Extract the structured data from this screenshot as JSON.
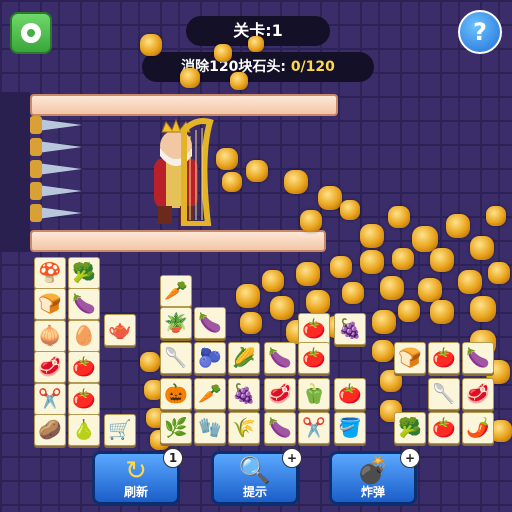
{
  "header": {
    "level_text": "关卡:1",
    "task_prefix": "消除120块石头: ",
    "task_progress": "0/120",
    "settings_icon": "gear-icon",
    "help_icon": "help-icon",
    "help_symbol": "?"
  },
  "colors": {
    "gold": "#e8a21a",
    "button": "#1b5ec9",
    "settings": "#45b045"
  },
  "tiles": [
    "🍄",
    "🥦",
    "🍞",
    "🍆",
    "🧅",
    "🥚",
    "🥩",
    "🍅",
    "✂️",
    "🍅",
    "🥔",
    "🍐",
    "🥕",
    "🪴",
    "🍆",
    "🍅",
    "🥄",
    "🫐",
    "🌽",
    "🍆",
    "🍅",
    "🍇",
    "🎃",
    "🥕",
    "🍇",
    "🥩",
    "🫑",
    "🍅",
    "🌿",
    "🧤",
    "🌾",
    "🍆",
    "✂️",
    "🪣",
    "🍞",
    "🍅",
    "🍆",
    "🥄",
    "🥦",
    "🍅",
    "🌶️",
    "🥩",
    "🫖",
    "🛒"
  ],
  "buttons": [
    {
      "label": "刷新",
      "icon": "↻",
      "badge": "1"
    },
    {
      "label": "提示",
      "icon": "🔍",
      "badge": "+"
    },
    {
      "label": "炸弹",
      "icon": "💣",
      "badge": "+"
    }
  ]
}
